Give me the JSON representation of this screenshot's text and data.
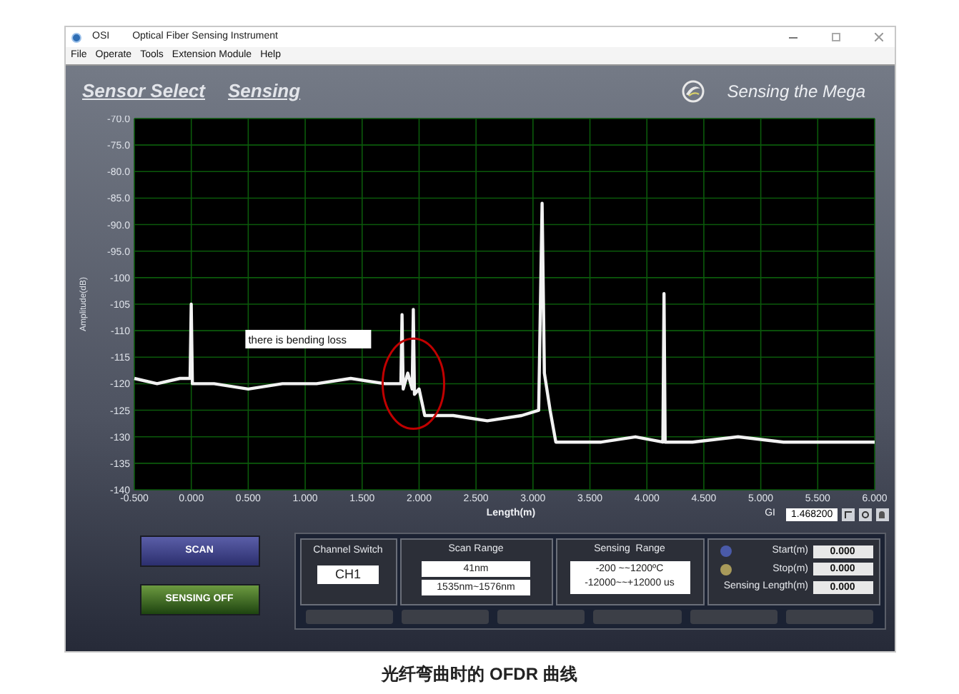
{
  "window": {
    "title": "OSI",
    "subtitle": "Optical Fiber Sensing Instrument"
  },
  "menu": [
    "File",
    "Operate",
    "Tools",
    "Extension Module",
    "Help"
  ],
  "tabs": [
    {
      "label": "Sensor Select",
      "selected": false
    },
    {
      "label": "Sensing",
      "selected": false
    }
  ],
  "brand": "Sensing the Mega",
  "chart": {
    "chart_data": {
      "type": "line",
      "xlabel": "Length(m)",
      "ylabel": "Amplitude(dB)",
      "xlim": [
        -0.5,
        6.0
      ],
      "ylim": [
        -140,
        -70
      ],
      "xticks": [
        {
          "value": -0.5,
          "label": "-0.500"
        },
        {
          "value": 0,
          "label": "0.000"
        },
        {
          "value": 0.5,
          "label": "0.500"
        },
        {
          "value": 1,
          "label": "1.000"
        },
        {
          "value": 1.5,
          "label": "1.500"
        },
        {
          "value": 2,
          "label": "2.000"
        },
        {
          "value": 2.5,
          "label": "2.500"
        },
        {
          "value": 3,
          "label": "3.000"
        },
        {
          "value": 3.5,
          "label": "3.500"
        },
        {
          "value": 4,
          "label": "4.000"
        },
        {
          "value": 4.5,
          "label": "4.500"
        },
        {
          "value": 5,
          "label": "5.000"
        },
        {
          "value": 5.5,
          "label": "5.500"
        },
        {
          "value": 6,
          "label": "6.000"
        }
      ],
      "yticks": [
        {
          "value": -70,
          "label": "-70.0"
        },
        {
          "value": -75,
          "label": "-75.0"
        },
        {
          "value": -80,
          "label": "-80.0"
        },
        {
          "value": -85,
          "label": "-85.0"
        },
        {
          "value": -90,
          "label": "-90.0"
        },
        {
          "value": -95,
          "label": "-95.0"
        },
        {
          "value": -100,
          "label": "-100"
        },
        {
          "value": -105,
          "label": "-105"
        },
        {
          "value": -110,
          "label": "-110"
        },
        {
          "value": -115,
          "label": "-115"
        },
        {
          "value": -120,
          "label": "-120"
        },
        {
          "value": -125,
          "label": "-125"
        },
        {
          "value": -130,
          "label": "-130"
        },
        {
          "value": -135,
          "label": "-135"
        },
        {
          "value": -140,
          "label": "-140"
        }
      ],
      "x": [
        -0.5,
        -0.3,
        -0.1,
        -0.01,
        0.0,
        0.01,
        0.2,
        0.5,
        0.8,
        1.1,
        1.4,
        1.7,
        1.84,
        1.85,
        1.86,
        1.9,
        1.94,
        1.95,
        1.96,
        2.0,
        2.05,
        2.3,
        2.6,
        2.9,
        3.05,
        3.08,
        3.1,
        3.15,
        3.2,
        3.3,
        3.6,
        3.9,
        4.14,
        4.15,
        4.16,
        4.4,
        4.8,
        5.2,
        5.6,
        6.0
      ],
      "grid": true,
      "series": [
        {
          "color": "#f2f2f2",
          "values": [
            -119,
            -120,
            -119,
            -119,
            -105,
            -120,
            -120,
            -121,
            -120,
            -120,
            -119,
            -120,
            -120,
            -107,
            -121,
            -118,
            -121,
            -106,
            -122,
            -121,
            -126,
            -126,
            -127,
            -126,
            -125,
            -86,
            -118,
            -125,
            -131,
            -131,
            -131,
            -130,
            -131,
            -103,
            -131,
            -131,
            -130,
            -131,
            -131,
            -131
          ]
        }
      ],
      "annotations": [
        "there is bending loss"
      ]
    }
  },
  "gi": {
    "label": "GI",
    "value": "1.468200"
  },
  "buttons": [
    {
      "label": "SCAN",
      "kind": "scan"
    },
    {
      "label": "SENSING OFF",
      "kind": "sensing"
    }
  ],
  "channel_switch": {
    "label": "Channel Switch",
    "value": "CH1"
  },
  "scan_range": {
    "label": "Scan Range",
    "values": [
      "41nm",
      "1535nm~1576nm"
    ]
  },
  "sensing_range": {
    "label": "Sensing  Range",
    "lines": [
      "-200 ~~1200ºC",
      "-12000~~+12000 us"
    ]
  },
  "positions": [
    {
      "label": "Start(m)",
      "value": "0.000"
    },
    {
      "label": "Stop(m)",
      "value": "0.000"
    },
    {
      "label": "Sensing Length(m)",
      "value": "0.000"
    }
  ],
  "caption": "光纤弯曲时的 OFDR 曲线"
}
